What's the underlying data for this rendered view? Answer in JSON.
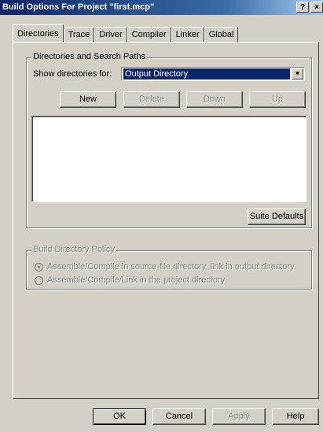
{
  "window": {
    "title": "Build Options For Project \"first.mcp\"",
    "help_glyph": "?",
    "close_glyph": "×"
  },
  "tabs": [
    {
      "label": "Directories",
      "active": true
    },
    {
      "label": "Trace"
    },
    {
      "label": "Driver"
    },
    {
      "label": "Compiler"
    },
    {
      "label": "Linker"
    },
    {
      "label": "Global"
    }
  ],
  "directories": {
    "group_label": "Directories and Search Paths",
    "show_for_label": "Show directories for:",
    "selected": "Output Directory",
    "buttons": {
      "new": "New",
      "delete": "Delete",
      "down": "Down",
      "up": "Up"
    },
    "suite_defaults": "Suite Defaults"
  },
  "build_policy": {
    "group_label": "Build Directory Policy",
    "option1": "Assemble/Compile in source-file directory, link in output directory",
    "option2": "Assemble/Compile/Link in the project directory"
  },
  "footer": {
    "ok": "OK",
    "cancel": "Cancel",
    "apply": "Apply",
    "help": "Help"
  }
}
